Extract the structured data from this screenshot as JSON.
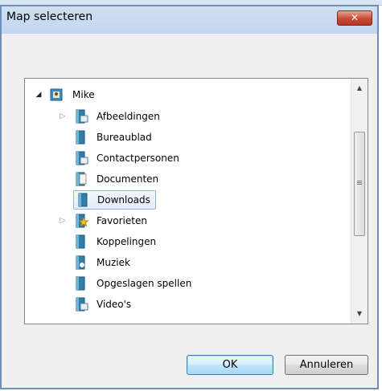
{
  "window": {
    "title": "Map selecteren",
    "close_label": "✕"
  },
  "tree": {
    "root": {
      "label": "Mike",
      "icon": "user-folder-icon",
      "expanded": true
    },
    "items": [
      {
        "label": "Afbeeldingen",
        "icon": "pictures-folder-icon",
        "expandable": true
      },
      {
        "label": "Bureaublad",
        "icon": "desktop-folder-icon",
        "expandable": false
      },
      {
        "label": "Contactpersonen",
        "icon": "contacts-folder-icon",
        "expandable": false
      },
      {
        "label": "Documenten",
        "icon": "documents-folder-icon",
        "expandable": false
      },
      {
        "label": "Downloads",
        "icon": "downloads-folder-icon",
        "expandable": false,
        "selected": true
      },
      {
        "label": "Favorieten",
        "icon": "favorites-folder-icon",
        "expandable": true
      },
      {
        "label": "Koppelingen",
        "icon": "links-folder-icon",
        "expandable": false
      },
      {
        "label": "Muziek",
        "icon": "music-folder-icon",
        "expandable": false
      },
      {
        "label": "Opgeslagen spellen",
        "icon": "saved-games-folder-icon",
        "expandable": false
      },
      {
        "label": "Video's",
        "icon": "videos-folder-icon",
        "expandable": false
      }
    ]
  },
  "buttons": {
    "ok": "OK",
    "cancel": "Annuleren"
  },
  "colors": {
    "selection_border": "#8fb5e0",
    "close_button": "#c74a34",
    "folder": "#2f7fa8"
  }
}
